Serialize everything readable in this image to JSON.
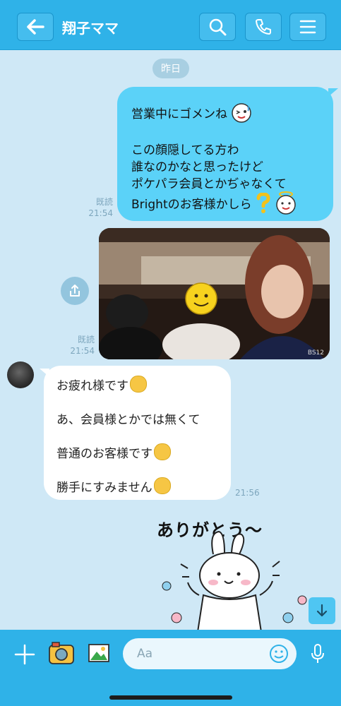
{
  "header": {
    "title": "翔子ママ",
    "back_icon": "back-arrow-icon",
    "search_icon": "search-icon",
    "call_icon": "phone-icon",
    "menu_icon": "menu-icon"
  },
  "date_divider": "昨日",
  "messages": {
    "outgoing_1": {
      "lines": [
        "営業中にゴメンね",
        "この顔隠してる方わ",
        "誰なのかなと思ったけど",
        "ポケパラ会員とかぢゃなくて",
        "Brightのお客様かしら"
      ],
      "read_label": "既読",
      "time": "21:54"
    },
    "outgoing_photo": {
      "read_label": "既読",
      "time": "21:54",
      "watermark": "BS12"
    },
    "incoming_1": {
      "lines": [
        "お疲れ様です",
        "あ、会員様とかでは無くて",
        "普通のお客様です",
        "勝手にすみません"
      ],
      "time": "21:56"
    },
    "sticker": {
      "text": "ありがとう～"
    }
  },
  "composer": {
    "placeholder": "Aa",
    "add_icon": "plus-icon",
    "camera_icon": "camera-icon",
    "image_icon": "image-icon",
    "emoji_icon": "smiley-icon",
    "mic_icon": "mic-icon"
  },
  "colors": {
    "header_bg": "#2fb2e8",
    "chat_bg": "#cfe8f6",
    "outgoing_bubble": "#5bd2f8",
    "incoming_bubble": "#ffffff"
  }
}
